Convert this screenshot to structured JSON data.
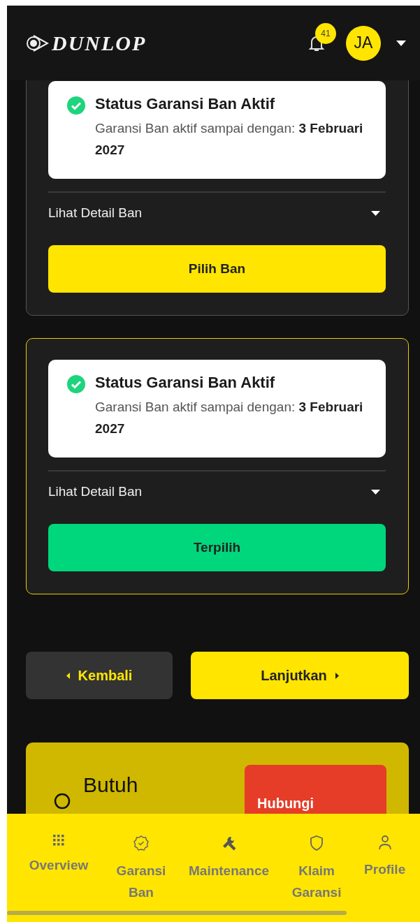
{
  "header": {
    "logo": "DUNLOP",
    "notification_count": "41",
    "avatar": "JA"
  },
  "tire_cards": [
    {
      "selected": false,
      "status_title": "Status Garansi Ban Aktif",
      "status_text": "Garansi Ban aktif sampai dengan: **3 Februari 2027**",
      "detail_toggle": "Lihat Detail Ban",
      "button": "Pilih Ban"
    },
    {
      "selected": true,
      "status_title": "Status Garansi Ban Aktif",
      "status_text": "Garansi Ban aktif sampai dengan: **3 Februari 2027**",
      "detail_toggle": "Lihat Detail Ban",
      "button": "Terpilih"
    }
  ],
  "navigation": {
    "back": "Kembali",
    "next": "Lanjutkan"
  },
  "help_card": {
    "title": "Butuh",
    "button": "Hubungi"
  },
  "bottom_nav": [
    {
      "kind": "grid",
      "label": "Overview"
    },
    {
      "kind": "badge",
      "label": "Garansi Ban"
    },
    {
      "kind": "wrench",
      "label": "Maintenance"
    },
    {
      "kind": "shield",
      "label": "Klaim Garansi"
    },
    {
      "kind": "person",
      "label": "Profile"
    }
  ]
}
